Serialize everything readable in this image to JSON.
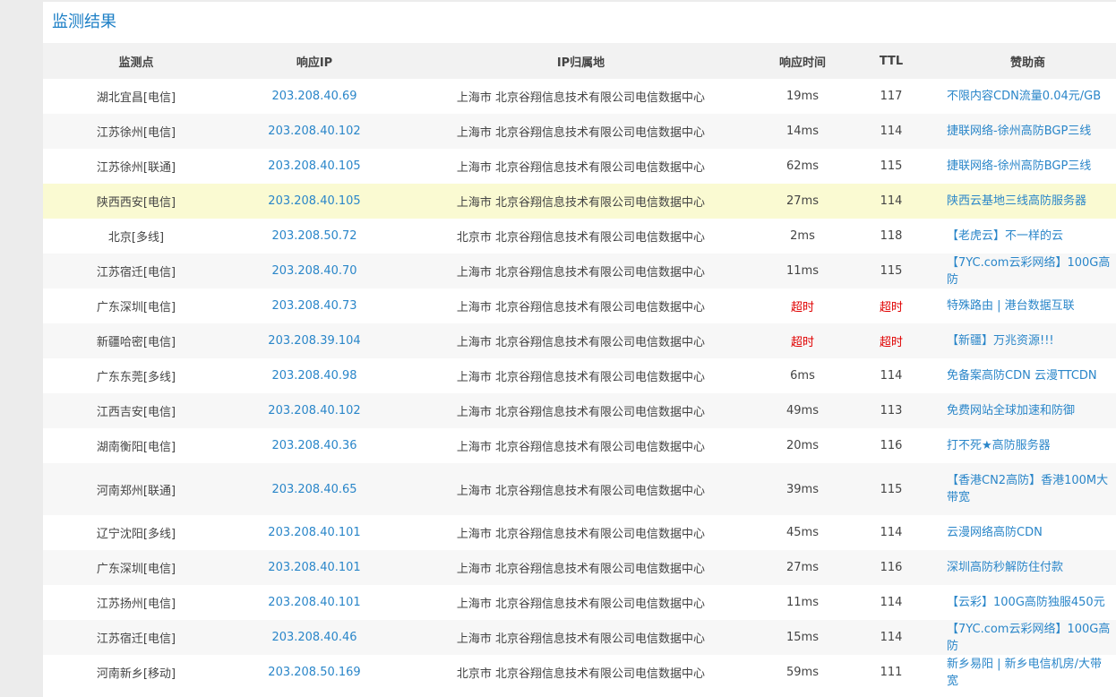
{
  "title": "监测结果",
  "headers": [
    "监测点",
    "响应IP",
    "IP归属地",
    "响应时间",
    "TTL",
    "赞助商"
  ],
  "highlight_color": "#fafad2",
  "link_color": "#2a86c9",
  "timeout_color": "#e00000",
  "rows": [
    {
      "point": "湖北宜昌[电信]",
      "ip": "203.208.40.69",
      "loc": "上海市 北京谷翔信息技术有限公司电信数据中心",
      "time": "19ms",
      "ttl": "117",
      "sponsor": "不限内容CDN流量0.04元/GB"
    },
    {
      "point": "江苏徐州[电信]",
      "ip": "203.208.40.102",
      "loc": "上海市 北京谷翔信息技术有限公司电信数据中心",
      "time": "14ms",
      "ttl": "114",
      "sponsor": "捷联网络-徐州高防BGP三线"
    },
    {
      "point": "江苏徐州[联通]",
      "ip": "203.208.40.105",
      "loc": "上海市 北京谷翔信息技术有限公司电信数据中心",
      "time": "62ms",
      "ttl": "115",
      "sponsor": "捷联网络-徐州高防BGP三线"
    },
    {
      "point": "陕西西安[电信]",
      "ip": "203.208.40.105",
      "loc": "上海市 北京谷翔信息技术有限公司电信数据中心",
      "time": "27ms",
      "ttl": "114",
      "sponsor": "陕西云基地三线高防服务器",
      "highlight": true
    },
    {
      "point": "北京[多线]",
      "ip": "203.208.50.72",
      "loc": "北京市 北京谷翔信息技术有限公司电信数据中心",
      "time": "2ms",
      "ttl": "118",
      "sponsor": "【老虎云】不一样的云"
    },
    {
      "point": "江苏宿迁[电信]",
      "ip": "203.208.40.70",
      "loc": "上海市 北京谷翔信息技术有限公司电信数据中心",
      "time": "11ms",
      "ttl": "115",
      "sponsor": "【7YC.com云彩网络】100G高防"
    },
    {
      "point": "广东深圳[电信]",
      "ip": "203.208.40.73",
      "loc": "上海市 北京谷翔信息技术有限公司电信数据中心",
      "time": "超时",
      "ttl": "超时",
      "sponsor": "特殊路由 | 港台数据互联",
      "timeout": true
    },
    {
      "point": "新疆哈密[电信]",
      "ip": "203.208.39.104",
      "loc": "上海市 北京谷翔信息技术有限公司电信数据中心",
      "time": "超时",
      "ttl": "超时",
      "sponsor": "【新疆】万兆资源!!!",
      "timeout": true
    },
    {
      "point": "广东东莞[多线]",
      "ip": "203.208.40.98",
      "loc": "上海市 北京谷翔信息技术有限公司电信数据中心",
      "time": "6ms",
      "ttl": "114",
      "sponsor": "免备案高防CDN 云漫TTCDN"
    },
    {
      "point": "江西吉安[电信]",
      "ip": "203.208.40.102",
      "loc": "上海市 北京谷翔信息技术有限公司电信数据中心",
      "time": "49ms",
      "ttl": "113",
      "sponsor": "免费网站全球加速和防御"
    },
    {
      "point": "湖南衡阳[电信]",
      "ip": "203.208.40.36",
      "loc": "上海市 北京谷翔信息技术有限公司电信数据中心",
      "time": "20ms",
      "ttl": "116",
      "sponsor": "打不死★高防服务器"
    },
    {
      "point": "河南郑州[联通]",
      "ip": "203.208.40.65",
      "loc": "上海市 北京谷翔信息技术有限公司电信数据中心",
      "time": "39ms",
      "ttl": "115",
      "sponsor": "【香港CN2高防】香港100M大带宽",
      "tall": true
    },
    {
      "point": "辽宁沈阳[多线]",
      "ip": "203.208.40.101",
      "loc": "上海市 北京谷翔信息技术有限公司电信数据中心",
      "time": "45ms",
      "ttl": "114",
      "sponsor": "云漫网络高防CDN"
    },
    {
      "point": "广东深圳[电信]",
      "ip": "203.208.40.101",
      "loc": "上海市 北京谷翔信息技术有限公司电信数据中心",
      "time": "27ms",
      "ttl": "116",
      "sponsor": "深圳高防秒解防住付款"
    },
    {
      "point": "江苏扬州[电信]",
      "ip": "203.208.40.101",
      "loc": "上海市 北京谷翔信息技术有限公司电信数据中心",
      "time": "11ms",
      "ttl": "114",
      "sponsor": "【云彩】100G高防独服450元"
    },
    {
      "point": "江苏宿迁[电信]",
      "ip": "203.208.40.46",
      "loc": "上海市 北京谷翔信息技术有限公司电信数据中心",
      "time": "15ms",
      "ttl": "114",
      "sponsor": "【7YC.com云彩网络】100G高防"
    },
    {
      "point": "河南新乡[移动]",
      "ip": "203.208.50.169",
      "loc": "北京市 北京谷翔信息技术有限公司电信数据中心",
      "time": "59ms",
      "ttl": "111",
      "sponsor": "新乡易阳 | 新乡电信机房/大带宽"
    }
  ]
}
